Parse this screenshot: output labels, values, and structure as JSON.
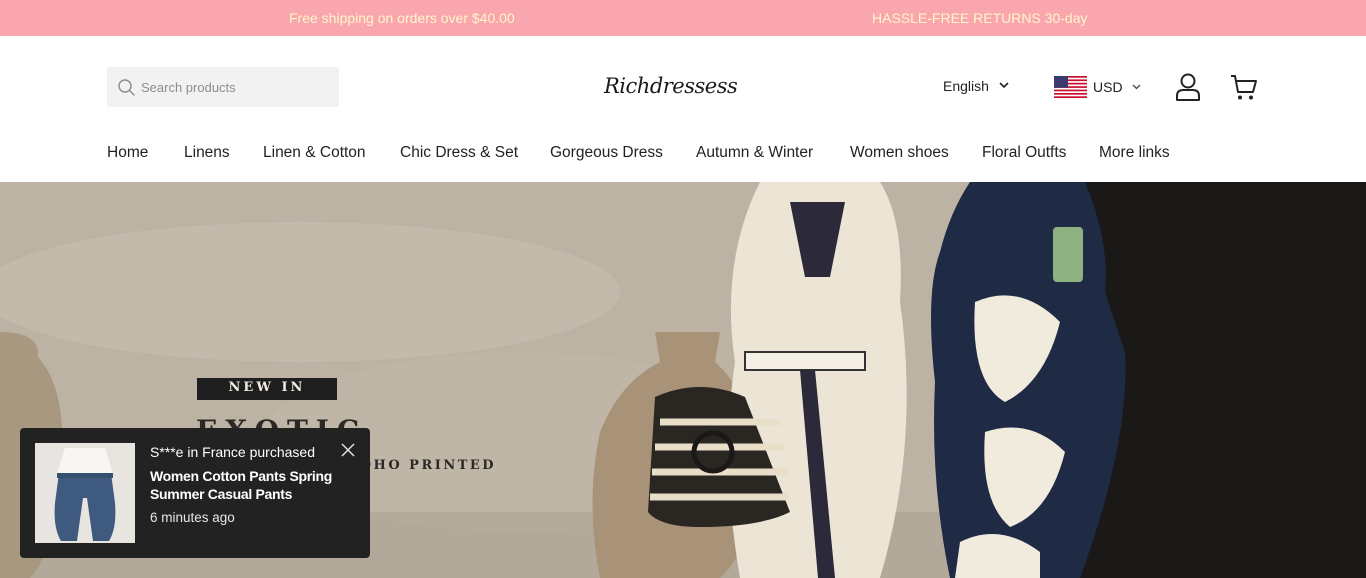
{
  "announcement": {
    "left_text": "Free shipping on orders over $40.00",
    "right_text": "HASSLE-FREE RETURNS 30-day"
  },
  "header": {
    "search_placeholder": "Search products",
    "logo_text": "Richdressess",
    "language": "English",
    "currency": "USD",
    "icons": [
      "search-icon",
      "chevron-down-icon",
      "us-flag-icon",
      "account-icon",
      "cart-icon"
    ]
  },
  "nav": {
    "items": [
      {
        "label": "Home"
      },
      {
        "label": "Linens"
      },
      {
        "label": "Linen & Cotton"
      },
      {
        "label": "Chic Dress & Set"
      },
      {
        "label": "Gorgeous Dress"
      },
      {
        "label": "Autumn & Winter"
      },
      {
        "label": "Women shoes"
      },
      {
        "label": "Floral Outfts"
      },
      {
        "label": "More links"
      }
    ]
  },
  "hero": {
    "badge": "NEW IN",
    "title": "EXOTIC",
    "subtitle": "BOHO PRINTED"
  },
  "popup": {
    "purchase_text": "S***e in France purchased",
    "product_name": "Women Cotton Pants Spring Summer Casual Pants",
    "time_ago": "6 minutes ago"
  },
  "colors": {
    "announcement_bg": "#f9a6ae",
    "announcement_text": "#fff7c9",
    "popup_bg": "#222222"
  }
}
